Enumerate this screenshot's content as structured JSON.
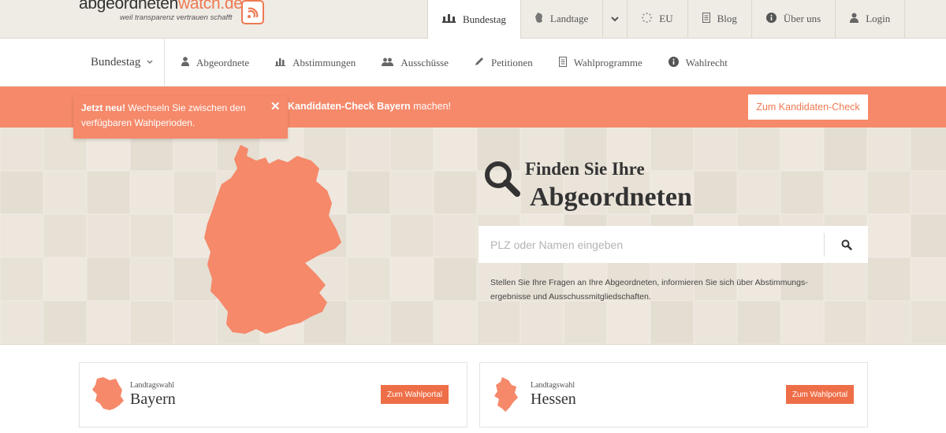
{
  "brand": {
    "name_part1": "abgeordneten",
    "name_part2": "watch.de",
    "tagline": "weil transparenz vertrauen schafft",
    "accent_color": "#ee7a52"
  },
  "topnav": {
    "items": [
      {
        "label": "Bundestag",
        "icon": "parliament-icon",
        "active": true
      },
      {
        "label": "Landtage",
        "icon": "germany-map-icon"
      },
      {
        "label": "EU",
        "icon": "eu-stars-icon"
      },
      {
        "label": "Blog",
        "icon": "document-icon"
      },
      {
        "label": "Über uns",
        "icon": "info-icon"
      },
      {
        "label": "Login",
        "icon": "user-icon"
      }
    ]
  },
  "subnav": {
    "section": "Bundestag",
    "links": [
      {
        "label": "Abgeordnete",
        "icon": "person-icon"
      },
      {
        "label": "Abstimmungen",
        "icon": "bar-chart-icon"
      },
      {
        "label": "Ausschüsse",
        "icon": "group-icon"
      },
      {
        "label": "Petitionen",
        "icon": "pen-icon"
      },
      {
        "label": "Wahlprogramme",
        "icon": "document-icon"
      },
      {
        "label": "Wahlrecht",
        "icon": "info-icon"
      }
    ]
  },
  "banner": {
    "message_bold": "Kandidaten-Check Bayern",
    "message_rest": " machen!",
    "cta": "Zum Kandidaten-Check",
    "color": "#f5896a"
  },
  "tooltip": {
    "bold": "Jetzt neu!",
    "text": " Wechseln Sie zwischen den verfügbaren Wahlperioden."
  },
  "hero": {
    "heading_line1": "Finden Sie Ihre",
    "heading_line2": "Abgeordneten",
    "search_placeholder": "PLZ oder Namen eingeben",
    "description": "Stellen Sie Ihre Fragen an Ihre Abgeordneten, informieren Sie sich über Abstimmungs­ergebnisse und Ausschussmitgliedschaften.",
    "map_color": "#f5896a"
  },
  "cards": [
    {
      "kicker": "Landtagswahl",
      "state": "Bayern",
      "button": "Zum Wahlportal"
    },
    {
      "kicker": "Landtagswahl",
      "state": "Hessen",
      "button": "Zum Wahlportal"
    }
  ]
}
